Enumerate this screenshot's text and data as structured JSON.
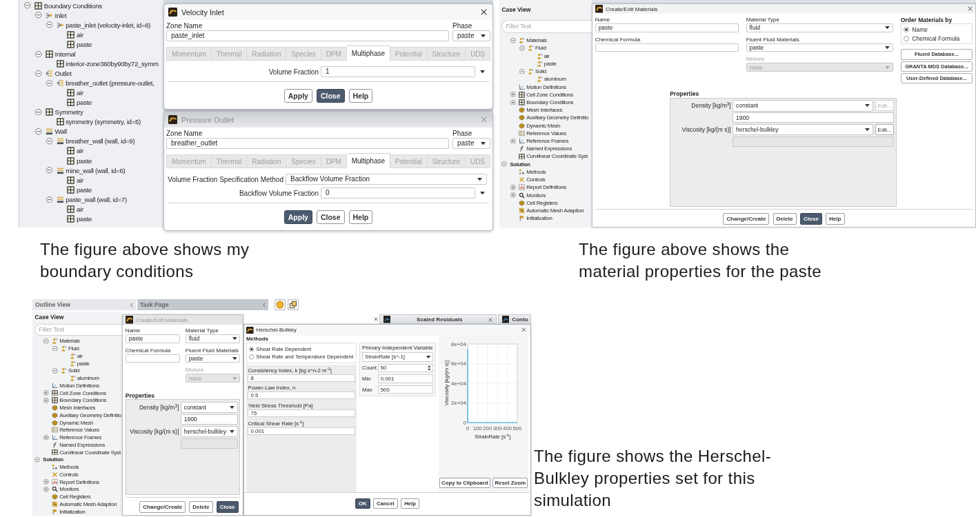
{
  "boundary_screenshot": {
    "tree": [
      {
        "label": "Boundary Conditions",
        "kind": "grid",
        "expanded": true,
        "children": [
          {
            "label": "Inlet",
            "kind": "inlet",
            "expanded": true,
            "children": [
              {
                "label": "paste_inlet (velocity-inlet, id=8)",
                "kind": "inlet",
                "expanded": true,
                "children": [
                  {
                    "label": "air",
                    "kind": "grid"
                  },
                  {
                    "label": "paste",
                    "kind": "grid"
                  }
                ]
              }
            ]
          },
          {
            "label": "Internal",
            "kind": "grid",
            "expanded": true,
            "children": [
              {
                "label": "interior-zone360by90by72_symm",
                "kind": "grid"
              }
            ]
          },
          {
            "label": "Outlet",
            "kind": "outlet",
            "expanded": true,
            "children": [
              {
                "label": "breather_outlet (pressure-outlet,",
                "kind": "outlet",
                "expanded": true,
                "children": [
                  {
                    "label": "air",
                    "kind": "grid"
                  },
                  {
                    "label": "paste",
                    "kind": "grid"
                  }
                ]
              }
            ]
          },
          {
            "label": "Symmetry",
            "kind": "grid",
            "expanded": true,
            "children": [
              {
                "label": "symmetry (symmetry, id=5)",
                "kind": "grid"
              }
            ]
          },
          {
            "label": "Wall",
            "kind": "wall",
            "expanded": true,
            "children": [
              {
                "label": "breather_wall (wall, id=9)",
                "kind": "wall",
                "expanded": true,
                "children": [
                  {
                    "label": "air",
                    "kind": "grid"
                  },
                  {
                    "label": "paste",
                    "kind": "grid"
                  }
                ]
              },
              {
                "label": "mine_wall (wall, id=6)",
                "kind": "wall",
                "expanded": true,
                "children": [
                  {
                    "label": "air",
                    "kind": "grid"
                  },
                  {
                    "label": "paste",
                    "kind": "grid"
                  }
                ]
              },
              {
                "label": "paste_wall (wall, id=7)",
                "kind": "wall",
                "expanded": true,
                "children": [
                  {
                    "label": "air",
                    "kind": "grid"
                  },
                  {
                    "label": "paste",
                    "kind": "grid"
                  }
                ]
              }
            ]
          }
        ]
      }
    ],
    "dialogs": [
      {
        "title": "Velocity Inlet",
        "active": true,
        "zone_label": "Zone Name",
        "zone_name": "paste_inlet",
        "phase_label": "Phase",
        "phase": "paste",
        "tabs": [
          {
            "label": "Momentum",
            "selected": false
          },
          {
            "label": "Thermal",
            "selected": false
          },
          {
            "label": "Radiation",
            "selected": false
          },
          {
            "label": "Species",
            "selected": false
          },
          {
            "label": "DPM",
            "selected": false
          },
          {
            "label": "Multiphase",
            "selected": true
          },
          {
            "label": "Potential",
            "selected": false
          },
          {
            "label": "Structure",
            "selected": false
          },
          {
            "label": "UDS",
            "selected": false
          }
        ],
        "fields": [
          {
            "label": "Volume Fraction",
            "value": "1",
            "kind": "expression"
          }
        ],
        "buttons": [
          {
            "label": "Apply",
            "default": false
          },
          {
            "label": "Close",
            "default": true
          },
          {
            "label": "Help",
            "default": false
          }
        ]
      },
      {
        "title": "Pressure Outlet",
        "active": false,
        "zone_label": "Zone Name",
        "zone_name": "breather_outlet",
        "phase_label": "Phase",
        "phase": "paste",
        "tabs": [
          {
            "label": "Momentum",
            "selected": false
          },
          {
            "label": "Thermal",
            "selected": false
          },
          {
            "label": "Radiation",
            "selected": false
          },
          {
            "label": "Species",
            "selected": false
          },
          {
            "label": "DPM",
            "selected": false
          },
          {
            "label": "Multiphase",
            "selected": true
          },
          {
            "label": "Potential",
            "selected": false
          },
          {
            "label": "Structure",
            "selected": false
          },
          {
            "label": "UDS",
            "selected": false
          }
        ],
        "fields": [
          {
            "label": "Volume Fraction Specification Method",
            "value": "Backflow Volume Fraction",
            "kind": "select"
          },
          {
            "label": "Backflow Volume Fraction",
            "value": "0",
            "kind": "expression"
          }
        ],
        "buttons": [
          {
            "label": "Apply",
            "default": true
          },
          {
            "label": "Close",
            "default": false
          },
          {
            "label": "Help",
            "default": false
          }
        ]
      }
    ]
  },
  "materials_screenshot": {
    "case_view": {
      "title": "Case View",
      "filter_placeholder": "Filter Text",
      "tree": [
        {
          "children": [
            {
              "label": "Materials",
              "kind": "material",
              "expanded": true,
              "children": [
                {
                  "label": "Fluid",
                  "kind": "material",
                  "expanded": true,
                  "children": [
                    {
                      "label": "air",
                      "kind": "material"
                    },
                    {
                      "label": "paste",
                      "kind": "material"
                    }
                  ]
                },
                {
                  "label": "Solid",
                  "kind": "material",
                  "expanded": true,
                  "children": [
                    {
                      "label": "aluminum",
                      "kind": "material"
                    }
                  ]
                }
              ]
            },
            {
              "label": "Motion Definitions",
              "kind": "axes"
            },
            {
              "label": "Cell Zone Conditions",
              "kind": "grid",
              "expanded": false
            },
            {
              "label": "Boundary Conditions",
              "kind": "grid",
              "expanded": false
            },
            {
              "label": "Mesh Interfaces",
              "kind": "mesh"
            },
            {
              "label": "Auxiliary Geometry Definitio",
              "kind": "geometry"
            },
            {
              "label": "Dynamic Mesh",
              "kind": "mesh"
            },
            {
              "label": "Reference Values",
              "kind": "table"
            },
            {
              "label": "Reference Frames",
              "kind": "axes",
              "expanded": false
            },
            {
              "label": "Named Expressions",
              "kind": "function"
            },
            {
              "label": "Curvilinear Coordinate Syst",
              "kind": "grid"
            }
          ]
        },
        {
          "label": "Solution",
          "kind": "section",
          "expanded": true,
          "children": [
            {
              "label": "Methods",
              "kind": "methods"
            },
            {
              "label": "Controls",
              "kind": "controls"
            },
            {
              "label": "Report Definitions",
              "kind": "report",
              "expanded": false
            },
            {
              "label": "Monitors",
              "kind": "monitor",
              "expanded": false
            },
            {
              "label": "Cell Registers",
              "kind": "register"
            },
            {
              "label": "Automatic Mesh Adaption",
              "kind": "adaption"
            },
            {
              "label": "Initialization",
              "kind": "init"
            }
          ]
        }
      ]
    },
    "materials_dialog": {
      "title": "Create/Edit Materials",
      "active": true,
      "left_fields": [
        {
          "label": "Name",
          "value": "paste",
          "kind": "input",
          "disabled": false
        },
        {
          "label": "Chemical Formula",
          "kind": "input",
          "disabled": false
        }
      ],
      "middle_fields": [
        {
          "label": "Material Type",
          "value": "fluid",
          "kind": "select",
          "disabled": false
        },
        {
          "label": "Fluent Fluid Materials",
          "value": "paste",
          "kind": "select",
          "disabled": false
        },
        {
          "label": "Mixture",
          "value": "none",
          "kind": "select",
          "disabled": true
        }
      ],
      "order_by": {
        "title": "Order Materials by",
        "options": [
          {
            "label": "Name",
            "selected": true
          },
          {
            "label": "Chemical Formula",
            "selected": false
          }
        ]
      },
      "database_buttons": [
        "Fluent Database...",
        "GRANTA MDS Database...",
        "User-Defined Database..."
      ],
      "properties_title": "Properties",
      "properties": [
        {
          "label": "Density [kg/m$^{3}$]",
          "method": "constant",
          "edit": {
            "label": "Edit...",
            "disabled": true
          },
          "value_field": {
            "value": "1900",
            "disabled": false
          }
        },
        {
          "label": "Viscosity [kg/(m s)]",
          "method": "herschel-bulkley",
          "edit": {
            "label": "Edit...",
            "disabled": false
          },
          "value_field": {
            "disabled": true
          }
        }
      ],
      "buttons": [
        {
          "label": "Change/Create",
          "default": false
        },
        {
          "label": "Delete",
          "default": false
        },
        {
          "label": "Close",
          "default": true
        },
        {
          "label": "Help",
          "default": false
        }
      ]
    }
  },
  "boundary_caption": "The figure above shows my boundary conditions",
  "materials_caption": "The figure above shows the material properties for the paste",
  "herschel_screenshot": {
    "outline_header": "Outline View",
    "task_header": "Task Page",
    "case_view": {
      "title": "Case View",
      "filter_placeholder": "Filter Text",
      "tree": [
        {
          "children": [
            {
              "label": "Materials",
              "kind": "material",
              "expanded": true,
              "children": [
                {
                  "label": "Fluid",
                  "kind": "material",
                  "expanded": true,
                  "children": [
                    {
                      "label": "air",
                      "kind": "material"
                    },
                    {
                      "label": "paste",
                      "kind": "material"
                    }
                  ]
                },
                {
                  "label": "Solid",
                  "kind": "material",
                  "expanded": true,
                  "children": [
                    {
                      "label": "aluminum",
                      "kind": "material"
                    }
                  ]
                }
              ]
            },
            {
              "label": "Motion Definitions",
              "kind": "axes"
            },
            {
              "label": "Cell Zone Conditions",
              "kind": "grid",
              "expanded": false
            },
            {
              "label": "Boundary Conditions",
              "kind": "grid",
              "expanded": false
            },
            {
              "label": "Mesh Interfaces",
              "kind": "mesh"
            },
            {
              "label": "Auxiliary Geometry Definitio",
              "kind": "geometry"
            },
            {
              "label": "Dynamic Mesh",
              "kind": "mesh"
            },
            {
              "label": "Reference Values",
              "kind": "table"
            },
            {
              "label": "Reference Frames",
              "kind": "axes",
              "expanded": false
            },
            {
              "label": "Named Expressions",
              "kind": "function"
            },
            {
              "label": "Curvilinear Coordinate Syst",
              "kind": "grid"
            }
          ]
        },
        {
          "label": "Solution",
          "kind": "section",
          "expanded": true,
          "children": [
            {
              "label": "Methods",
              "kind": "methods"
            },
            {
              "label": "Controls",
              "kind": "controls"
            },
            {
              "label": "Report Definitions",
              "kind": "report",
              "expanded": false
            },
            {
              "label": "Monitors",
              "kind": "monitor",
              "expanded": false
            },
            {
              "label": "Cell Registers",
              "kind": "register"
            },
            {
              "label": "Automatic Mesh Adaption",
              "kind": "adaption"
            },
            {
              "label": "Initialization",
              "kind": "init"
            }
          ]
        }
      ]
    },
    "materials_dialog": {
      "title": "Create/Edit Materials",
      "active": false,
      "left_fields": [
        {
          "label": "Name",
          "value": "paste",
          "kind": "input",
          "disabled": false
        },
        {
          "label": "Chemical Formula",
          "kind": "input",
          "disabled": false
        }
      ],
      "middle_fields": [
        {
          "label": "Material Type",
          "value": "fluid",
          "kind": "select",
          "disabled": false
        },
        {
          "label": "Fluent Fluid Materials",
          "value": "paste",
          "kind": "select",
          "disabled": false
        },
        {
          "label": "Mixture",
          "value": "none",
          "kind": "select",
          "disabled": true
        }
      ],
      "properties_title": "Properties",
      "properties": [
        {
          "label": "Density [kg/m$^{3}$]",
          "method": "constant",
          "value_field": {
            "value": "1900",
            "disabled": false
          }
        },
        {
          "label": "Viscosity [kg/(m s)]",
          "method": "herschel-bulkley",
          "value_field": {
            "disabled": true
          }
        }
      ],
      "buttons": [
        {
          "label": "Change/Create",
          "default": false
        },
        {
          "label": "Delete",
          "default": false
        },
        {
          "label": "Close",
          "default": true
        }
      ]
    },
    "graphics_tabs": [
      {
        "label": "Scaled Residuals"
      },
      {
        "label": "Conto"
      }
    ],
    "herschel_dialog": {
      "title": "Herschel-Bulkley",
      "active": true,
      "methods_title": "Methods",
      "methods": [
        {
          "label": "Shear Rate Dependent",
          "selected": true
        },
        {
          "label": "Shear Rate and Temperature Dependent",
          "selected": false
        }
      ],
      "parameters": [
        {
          "label": "Consistency Index, k [kg s^n-2 m$^{-1}$]",
          "value": "8"
        },
        {
          "label": "Power-Law Index, n",
          "value": "0.5"
        },
        {
          "label": "Yield Stress Threshold [Pa]",
          "value": "75"
        },
        {
          "label": "Critical Shear Rate [s$^{-1}$]",
          "value": "0.001"
        }
      ],
      "plot_settings": {
        "title": "Primary Independent Variable",
        "variable": "StrainRate [s^-1]",
        "ranges": [
          {
            "label": "Count",
            "value": "50",
            "kind": "spin"
          },
          {
            "label": "Min",
            "value": "0.001",
            "kind": "input"
          },
          {
            "label": "Max",
            "value": "500",
            "kind": "input"
          }
        ]
      },
      "chart_data": {
        "type": "line",
        "xlabel": "StrainRate [s$^{-1}$]",
        "ylabel": "Viscosity [kg/(m s)]",
        "x": [
          0.001,
          1,
          100,
          200,
          300,
          400,
          500
        ],
        "series": [
          {
            "color": "#33aee6",
            "values": [
              75000,
              0,
              0,
              0,
              0,
              0,
              0
            ]
          }
        ],
        "xlim": [
          0,
          500
        ],
        "ylim": [
          0,
          80000
        ],
        "xticks": [
          0,
          100,
          200,
          300,
          400,
          500
        ],
        "yticks": [
          {
            "value": 0,
            "label": "0"
          },
          {
            "value": 20000,
            "label": "2e+04"
          },
          {
            "value": 40000,
            "label": "4e+04"
          },
          {
            "value": 60000,
            "label": "6e+04"
          },
          {
            "value": 80000,
            "label": "8e+04"
          }
        ],
        "grid": true
      },
      "chart_buttons": [
        "Copy to Clipboard",
        "Reset Zoom"
      ],
      "buttons": [
        {
          "label": "OK",
          "default": true
        },
        {
          "label": "Cancel",
          "default": false
        },
        {
          "label": "Help",
          "default": false
        }
      ]
    }
  },
  "herschel_caption": "The figure shows the Herschel-Bulkley properties set for this simulation"
}
